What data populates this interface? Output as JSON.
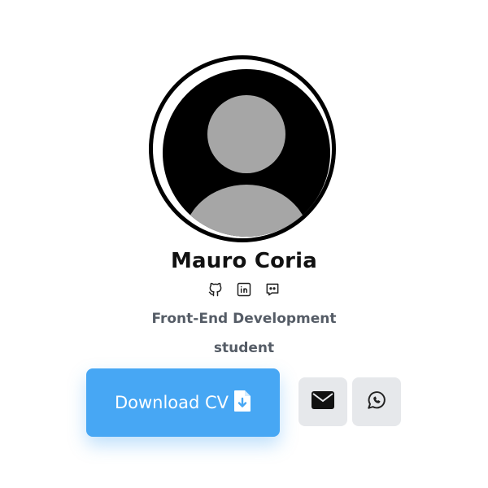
{
  "profile": {
    "name": "Mauro Coria",
    "role_line1": "Front-End Development",
    "role_line2": "student"
  },
  "socials": [
    {
      "icon": "github-icon"
    },
    {
      "icon": "linkedin-icon"
    },
    {
      "icon": "discord-icon"
    }
  ],
  "actions": {
    "download_label": "Download CV",
    "download_icon": "file-download-icon",
    "email_icon": "envelope-icon",
    "whatsapp_icon": "whatsapp-icon"
  },
  "colors": {
    "accent": "#47a7f4",
    "secondary_button": "#e6e8eb",
    "name_text": "#111111",
    "muted_text": "#555c66"
  }
}
